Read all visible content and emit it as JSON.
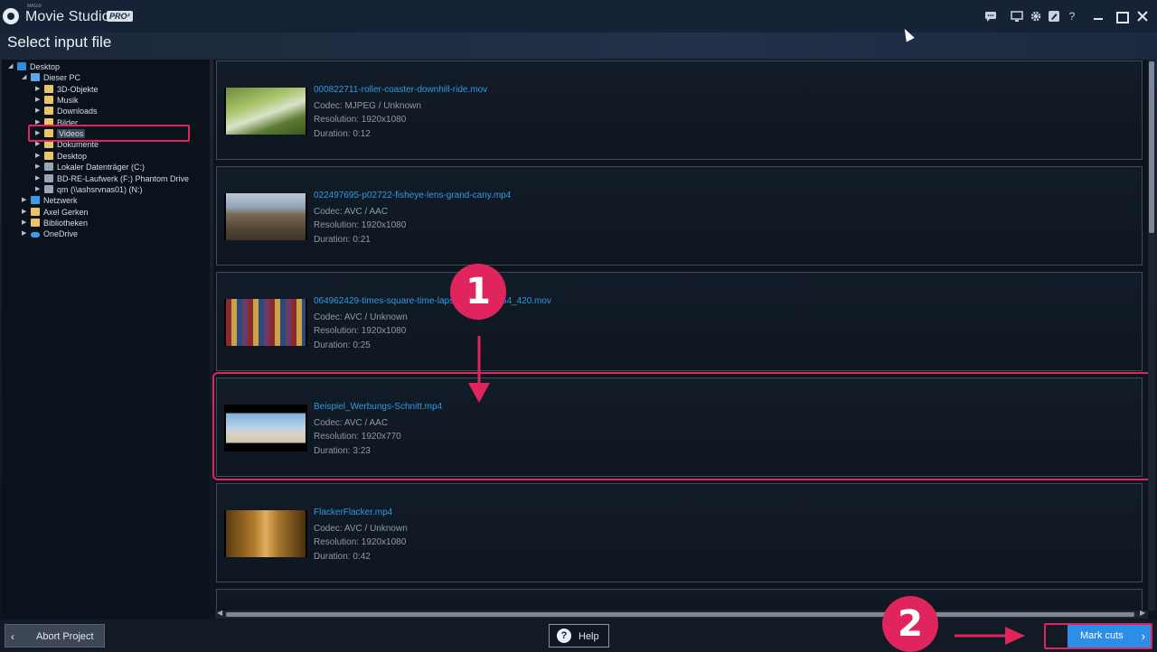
{
  "titlebar": {
    "brand_small": "MAGIX",
    "app_title": "Movie Studio",
    "pro_badge": "PRO²",
    "icons": [
      "chat-icon",
      "monitor-icon",
      "gear-icon",
      "edit-icon",
      "help-icon"
    ],
    "help_glyph": "?"
  },
  "page": {
    "title": "Select input file"
  },
  "tree": {
    "items": [
      {
        "label": "Desktop",
        "icon": "monitor-icon",
        "arrow": "◢"
      },
      {
        "label": "Dieser PC",
        "icon": "pc-icon",
        "arrow": "◢"
      },
      {
        "label": "3D-Objekte",
        "icon": "folder-icon",
        "arrow": "▶"
      },
      {
        "label": "Musik",
        "icon": "folder-icon",
        "arrow": "▶"
      },
      {
        "label": "Downloads",
        "icon": "folder-icon",
        "arrow": "▶"
      },
      {
        "label": "Bilder",
        "icon": "folder-icon",
        "arrow": "▶"
      },
      {
        "label": "Videos",
        "icon": "folder-icon",
        "arrow": "▶"
      },
      {
        "label": "Dokumente",
        "icon": "folder-icon",
        "arrow": "▶"
      },
      {
        "label": "Desktop",
        "icon": "folder-icon",
        "arrow": "▶"
      },
      {
        "label": "Lokaler Datenträger (C:)",
        "icon": "drive-icon",
        "arrow": "▶"
      },
      {
        "label": "BD-RE-Laufwerk (F:) Phantom Drive",
        "icon": "drive-icon",
        "arrow": "▶"
      },
      {
        "label": "qm (\\\\ashsrvnas01) (N:)",
        "icon": "drive-icon",
        "arrow": "▶"
      },
      {
        "label": "Netzwerk",
        "icon": "network-icon",
        "arrow": "▶"
      },
      {
        "label": "Axel Gerken",
        "icon": "folder-icon",
        "arrow": "▶"
      },
      {
        "label": "Bibliotheken",
        "icon": "folder-icon",
        "arrow": "▶"
      },
      {
        "label": "OneDrive",
        "icon": "cloud-icon",
        "arrow": "▶"
      }
    ],
    "selected": "Videos"
  },
  "files": [
    {
      "name": "000822711-roller-coaster-downhill-ride.mov",
      "codec": "Codec: MJPEG / Unknown",
      "resolution": "Resolution: 1920x1080",
      "duration": "Duration: 0:12"
    },
    {
      "name": "022497695-p02722-fisheye-lens-grand-cany.mp4",
      "codec": "Codec: AVC / AAC",
      "resolution": "Resolution: 1920x1080",
      "duration": "Duration: 0:21"
    },
    {
      "name": "064962429-times-square-time-lapse-1080p-H264_420.mov",
      "codec": "Codec: AVC / Unknown",
      "resolution": "Resolution: 1920x1080",
      "duration": "Duration: 0:25"
    },
    {
      "name": "Beispiel_Werbungs-Schnitt.mp4",
      "codec": "Codec: AVC / AAC",
      "resolution": "Resolution: 1920x770",
      "duration": "Duration: 3:23"
    },
    {
      "name": "FlackerFlacker.mp4",
      "codec": "Codec: AVC / Unknown",
      "resolution": "Resolution: 1920x1080",
      "duration": "Duration: 0:42"
    }
  ],
  "footer": {
    "abort_label": "Abort Project",
    "help_label": "Help",
    "mark_label": "Mark cuts",
    "back_chevron": "‹",
    "next_chevron": "›",
    "help_glyph": "?"
  },
  "annotations": {
    "step1": "1",
    "step2": "2"
  },
  "colors": {
    "accent": "#2c8ee6",
    "link": "#2f9be0",
    "highlight": "#e0245e"
  }
}
